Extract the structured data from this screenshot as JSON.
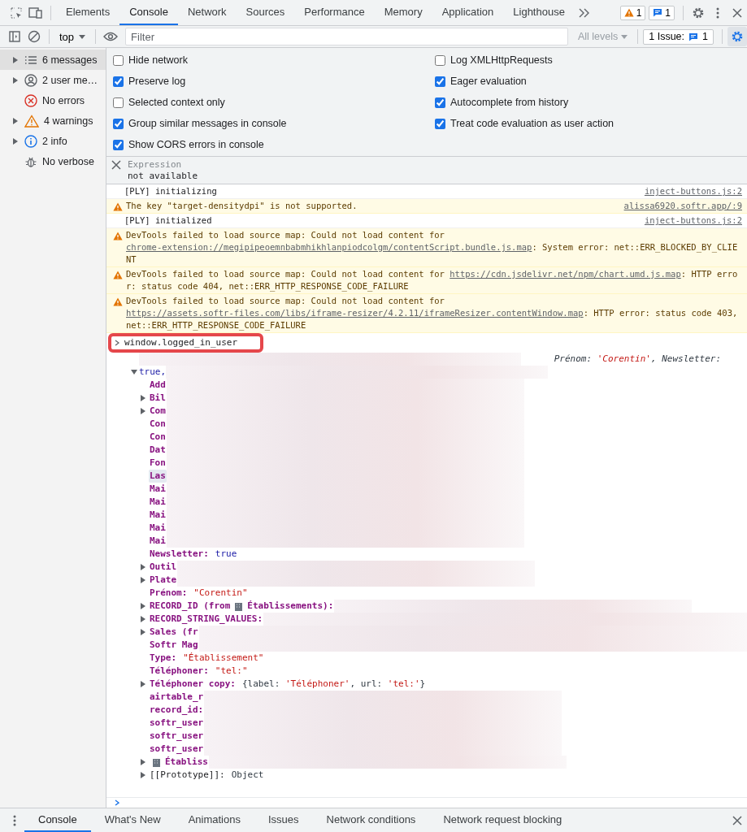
{
  "main_tabs": [
    {
      "label": "Elements",
      "selected": false
    },
    {
      "label": "Console",
      "selected": true
    },
    {
      "label": "Network",
      "selected": false
    },
    {
      "label": "Sources",
      "selected": false
    },
    {
      "label": "Performance",
      "selected": false
    },
    {
      "label": "Memory",
      "selected": false
    },
    {
      "label": "Application",
      "selected": false
    },
    {
      "label": "Lighthouse",
      "selected": false
    }
  ],
  "badges": [
    {
      "kind": "warning",
      "count": "1"
    },
    {
      "kind": "message",
      "count": "1"
    }
  ],
  "toolbar": {
    "context": "top",
    "filter": {
      "placeholder": "Filter"
    },
    "levels": "All levels",
    "issues": {
      "label": "1 Issue:",
      "count": "1"
    },
    "settings_open": true
  },
  "sidebar": [
    {
      "kind": "list",
      "label": "6 messages",
      "expandable": true,
      "selected": true
    },
    {
      "kind": "user",
      "label": "2 user me…",
      "expandable": true,
      "selected": false
    },
    {
      "kind": "error",
      "label": "No errors",
      "expandable": false,
      "selected": false
    },
    {
      "kind": "warning",
      "label": "4 warnings",
      "expandable": true,
      "selected": false
    },
    {
      "kind": "info",
      "label": "2 info",
      "expandable": true,
      "selected": false
    },
    {
      "kind": "verbose",
      "label": "No verbose",
      "expandable": false,
      "selected": false
    }
  ],
  "settings": {
    "left": [
      {
        "label": "Hide network",
        "checked": false
      },
      {
        "label": "Preserve log",
        "checked": true
      },
      {
        "label": "Selected context only",
        "checked": false
      },
      {
        "label": "Group similar messages in console",
        "checked": true
      },
      {
        "label": "Show CORS errors in console",
        "checked": true
      }
    ],
    "right": [
      {
        "label": "Log XMLHttpRequests",
        "checked": false
      },
      {
        "label": "Eager evaluation",
        "checked": true
      },
      {
        "label": "Autocomplete from history",
        "checked": true
      },
      {
        "label": "Treat code evaluation as user action",
        "checked": true
      }
    ]
  },
  "expression": {
    "label": "Expression",
    "value": "not available"
  },
  "messages": [
    {
      "kind": "log",
      "text": "[PLY] initializing",
      "source": "inject-buttons.js:2"
    },
    {
      "kind": "warning",
      "text": "The key \"target-densitydpi\" is not supported.",
      "source": "alissa6920.softr.app/:9"
    },
    {
      "kind": "log",
      "text": "[PLY] initialized",
      "source": "inject-buttons.js:2"
    },
    {
      "kind": "warning",
      "text": "DevTools failed to load source map: Could not load content for ",
      "link": "chrome-extension://megipipeoemnbabmhikhlanpiodcolgm/contentScript.bundle.js.map",
      "after": ": System error: net::ERR_BLOCKED_BY_CLIENT"
    },
    {
      "kind": "warning",
      "text": "DevTools failed to load source map: Could not load content for ",
      "link": "https://cdn.jsdelivr.net/npm/chart.umd.js.map",
      "after": ": HTTP error: status code 404, net::ERR_HTTP_RESPONSE_CODE_FAILURE"
    },
    {
      "kind": "warning",
      "text": "DevTools failed to load source map: Could not load content for ",
      "link": "https://assets.softr-files.com/libs/iframe-resizer/4.2.11/iframeResizer.contentWindow.map",
      "after": ": HTTP error: status code 403, net::ERR_HTTP_RESPONSE_CODE_FAILURE"
    }
  ],
  "command": {
    "text": "window.logged_in_user",
    "highlighted": true
  },
  "result": {
    "expanded": true,
    "preview": [
      {
        "kind": "key",
        "text": "Prénom: "
      },
      {
        "kind": "string",
        "text": "'Corentin'"
      },
      {
        "kind": "key",
        "text": ", Newsletter:"
      }
    ],
    "continuation": "true,",
    "rows": [
      {
        "key": "Add",
        "expandable": false,
        "redacted": true,
        "selected": false
      },
      {
        "key": "Bil",
        "expandable": true,
        "redacted": true,
        "selected": false
      },
      {
        "key": "Com",
        "expandable": true,
        "redacted": true,
        "selected": false
      },
      {
        "key": "Con",
        "expandable": false,
        "redacted": true,
        "selected": false
      },
      {
        "key": "Con",
        "expandable": false,
        "redacted": true,
        "selected": false
      },
      {
        "key": "Dat",
        "expandable": false,
        "redacted": true,
        "selected": false
      },
      {
        "key": "Fon",
        "expandable": false,
        "redacted": true,
        "selected": false
      },
      {
        "key": "Las",
        "expandable": false,
        "redacted": true,
        "selected": true
      },
      {
        "key": "Mai",
        "expandable": false,
        "redacted": true,
        "selected": false
      },
      {
        "key": "Mai",
        "expandable": false,
        "redacted": true,
        "selected": false
      },
      {
        "key": "Mai",
        "expandable": false,
        "redacted": true,
        "selected": false
      },
      {
        "key": "Mai",
        "expandable": false,
        "redacted": true,
        "selected": false
      },
      {
        "key": "Mai",
        "expandable": false,
        "redacted": true,
        "selected": false
      },
      {
        "key": "Newsletter:",
        "value": [
          {
            "kind": "bool",
            "text": "true"
          }
        ],
        "expandable": false,
        "selected": false
      },
      {
        "key": "Outil",
        "expandable": true,
        "redacted": true,
        "selected": false
      },
      {
        "key": "Plate",
        "expandable": true,
        "redacted": true,
        "selected": false
      },
      {
        "key": "Prénom:",
        "value": [
          {
            "kind": "string",
            "text": "\"Corentin\""
          }
        ],
        "expandable": false,
        "selected": false
      },
      {
        "key": "RECORD_ID (from",
        "icon": true,
        "key_after": "Établissements):",
        "expandable": true,
        "redacted": true,
        "selected": false
      },
      {
        "key": "RECORD_STRING_VALUES:",
        "expandable": true,
        "redacted": true,
        "to_edge": true,
        "selected": false
      },
      {
        "key": "Sales (fr",
        "expandable": true,
        "redacted": true,
        "to_edge": true,
        "selected": false
      },
      {
        "key": "Softr Mag",
        "expandable": false,
        "redacted": true,
        "to_edge": true,
        "selected": false
      },
      {
        "key": "Type:",
        "value": [
          {
            "kind": "string",
            "text": "\"Établissement\""
          }
        ],
        "expandable": false,
        "selected": false
      },
      {
        "key": "Téléphoner:",
        "value": [
          {
            "kind": "string",
            "text": "\"tel:\""
          }
        ],
        "expandable": false,
        "selected": false
      },
      {
        "key": "Téléphoner copy:",
        "value": [
          {
            "kind": "plain",
            "text": "{label: "
          },
          {
            "kind": "string",
            "text": "'Téléphoner'"
          },
          {
            "kind": "plain",
            "text": ", url: "
          },
          {
            "kind": "string",
            "text": "'tel:'"
          },
          {
            "kind": "plain",
            "text": "}"
          }
        ],
        "expandable": true,
        "selected": false
      },
      {
        "key": "airtable_r",
        "expandable": false,
        "redacted": true,
        "selected": false
      },
      {
        "key": "record_id:",
        "expandable": false,
        "redacted": true,
        "selected": false
      },
      {
        "key": "softr_user",
        "expandable": false,
        "redacted": true,
        "selected": false
      },
      {
        "key": "softr_user",
        "expandable": false,
        "redacted": true,
        "selected": false
      },
      {
        "key": "softr_user",
        "expandable": false,
        "redacted": true,
        "selected": false
      },
      {
        "icon": true,
        "key_after": "Établiss",
        "expandable": true,
        "redacted": true,
        "selected": false
      },
      {
        "key": "[[Prototype]]:",
        "internal": true,
        "value": [
          {
            "kind": "plain",
            "text": "Object"
          }
        ],
        "expandable": true,
        "selected": false
      }
    ]
  },
  "drawer_tabs": [
    {
      "label": "Console",
      "selected": true
    },
    {
      "label": "What's New",
      "selected": false
    },
    {
      "label": "Animations",
      "selected": false
    },
    {
      "label": "Issues",
      "selected": false
    },
    {
      "label": "Network conditions",
      "selected": false
    },
    {
      "label": "Network request blocking",
      "selected": false
    }
  ]
}
